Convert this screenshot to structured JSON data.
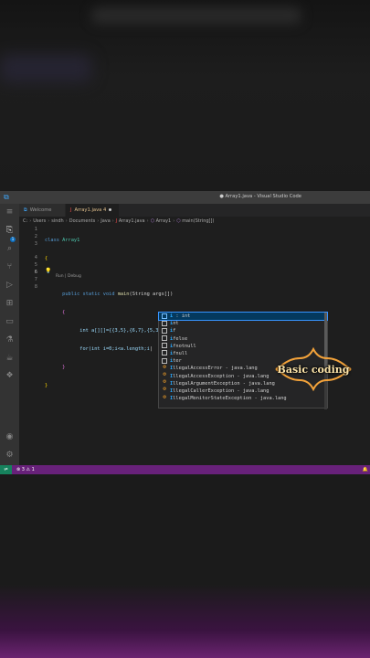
{
  "window": {
    "title": "● Array1.java - Visual Studio Code"
  },
  "tabs": [
    {
      "label": "Welcome"
    },
    {
      "label": "Array1.java 4"
    }
  ],
  "breadcrumb": {
    "path": [
      "C:",
      "Users",
      "sindh",
      "Documents",
      "Java",
      "Array1.java",
      "Array1",
      "main(String[])"
    ]
  },
  "editor": {
    "line_numbers": [
      "1",
      "2",
      "3",
      "4",
      "5",
      "6",
      "7",
      "8"
    ],
    "codelens": "Run | Debug",
    "lines": {
      "l1_kw": "class",
      "l1_name": " Array1",
      "l2": "{",
      "l3_kw": "public static void",
      "l3_fn": " main",
      "l3_rest": "(String args[])",
      "l4": "{",
      "l5": "int a[][]={{3,5},{6,7},{5,3},{7,9}};",
      "l6": "for(int i=0;i<a.length;i",
      "l6_cursor": "|",
      "l7": "}",
      "l8": "}"
    }
  },
  "suggestions": [
    {
      "icon": "snippet-icon",
      "label": "i : int",
      "highlight": "i"
    },
    {
      "icon": "snippet-icon",
      "label": "int",
      "highlight": "i"
    },
    {
      "icon": "snippet-icon",
      "label": "if",
      "highlight": "i"
    },
    {
      "icon": "snippet-icon",
      "label": "ifelse",
      "highlight": "i"
    },
    {
      "icon": "snippet-icon",
      "label": "ifnotnull",
      "highlight": "i"
    },
    {
      "icon": "snippet-icon",
      "label": "ifnull",
      "highlight": "i"
    },
    {
      "icon": "snippet-icon",
      "label": "iter",
      "highlight": "i"
    },
    {
      "icon": "class-icon",
      "label": "IllegalAccessError - java.lang",
      "highlight": "I"
    },
    {
      "icon": "class-icon",
      "label": "IllegalAccessException - java.lang",
      "highlight": "I"
    },
    {
      "icon": "class-icon",
      "label": "IllegalArgumentException - java.lang",
      "highlight": "I"
    },
    {
      "icon": "class-icon",
      "label": "IllegalCallerException - java.lang",
      "highlight": "I"
    },
    {
      "icon": "class-icon",
      "label": "IllegalMonitorStateException - java.lang",
      "highlight": "I"
    }
  ],
  "statusbar": {
    "errors": "3",
    "warnings": "1"
  },
  "watermark": {
    "text": "Basic coding"
  },
  "colors": {
    "statusbar": "#68217a",
    "remote": "#16825d",
    "accent": "#3794ff"
  }
}
